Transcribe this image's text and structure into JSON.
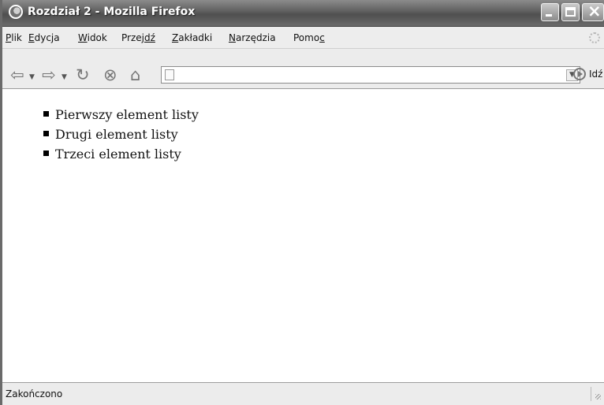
{
  "window": {
    "title": "Rozdział 2 - Mozilla Firefox"
  },
  "menu": [
    {
      "pre": "",
      "accel": "P",
      "post": "lik"
    },
    {
      "pre": "",
      "accel": "E",
      "post": "dycja"
    },
    {
      "pre": "",
      "accel": "W",
      "post": "idok"
    },
    {
      "pre": "Prze",
      "accel": "jdź",
      "post": ""
    },
    {
      "pre": "",
      "accel": "Z",
      "post": "akładki"
    },
    {
      "pre": "",
      "accel": "N",
      "post": "arzędzia"
    },
    {
      "pre": "Pomo",
      "accel": "c",
      "post": ""
    }
  ],
  "toolbar": {
    "address_value": "",
    "go_label": "Idź"
  },
  "content": {
    "list_items": [
      "Pierwszy element listy",
      "Drugi element listy",
      "Trzeci element listy"
    ]
  },
  "status": {
    "text": "Zakończono"
  },
  "icons": {
    "back": "back-arrow-icon",
    "forward": "forward-arrow-icon",
    "reload": "reload-icon",
    "stop": "stop-icon",
    "home": "home-icon",
    "go": "go-icon"
  }
}
